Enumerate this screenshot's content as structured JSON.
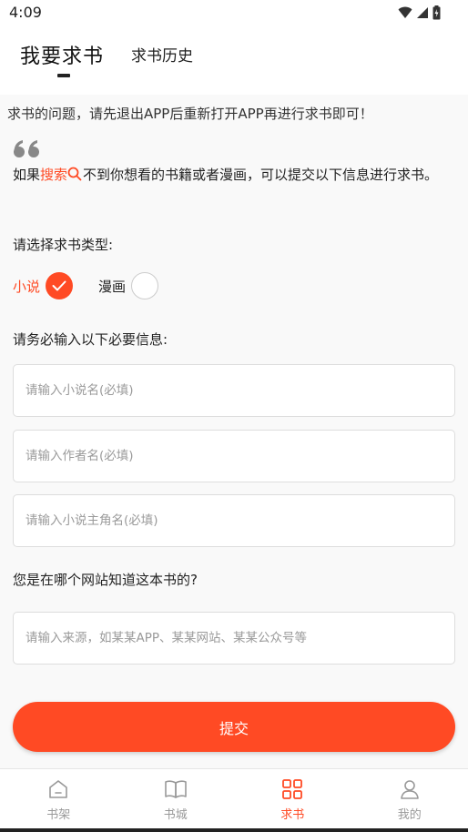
{
  "status_bar": {
    "time": "4:09"
  },
  "header": {
    "active_tab": "我要求书",
    "other_tab": "求书历史"
  },
  "notice": {
    "marquee": "求书的问题，请先退出APP后重新打开APP再进行求书即可！",
    "intro_before": "如果",
    "intro_highlight": "搜索",
    "intro_after": "不到你想看的书籍或者漫画，可以提交以下信息进行求书。"
  },
  "form": {
    "type_label": "请选择求书类型:",
    "types": [
      {
        "label": "小说",
        "selected": true
      },
      {
        "label": "漫画",
        "selected": false
      }
    ],
    "required_label": "请务必输入以下必要信息:",
    "novel_name_placeholder": "请输入小说名(必填)",
    "author_placeholder": "请输入作者名(必填)",
    "protagonist_placeholder": "请输入小说主角名(必填)",
    "source_question": "您是在哪个网站知道这本书的?",
    "source_placeholder": "请输入来源，如某某APP、某某网站、某某公众号等",
    "submit_label": "提交"
  },
  "bottom_nav": [
    {
      "label": "书架",
      "icon": "home-icon",
      "active": false
    },
    {
      "label": "书城",
      "icon": "book-icon",
      "active": false
    },
    {
      "label": "求书",
      "icon": "grid-icon",
      "active": true
    },
    {
      "label": "我的",
      "icon": "person-icon",
      "active": false
    }
  ],
  "colors": {
    "accent": "#ff4a24",
    "inactive_nav": "#999999",
    "content_bg": "#f9f9f9"
  }
}
